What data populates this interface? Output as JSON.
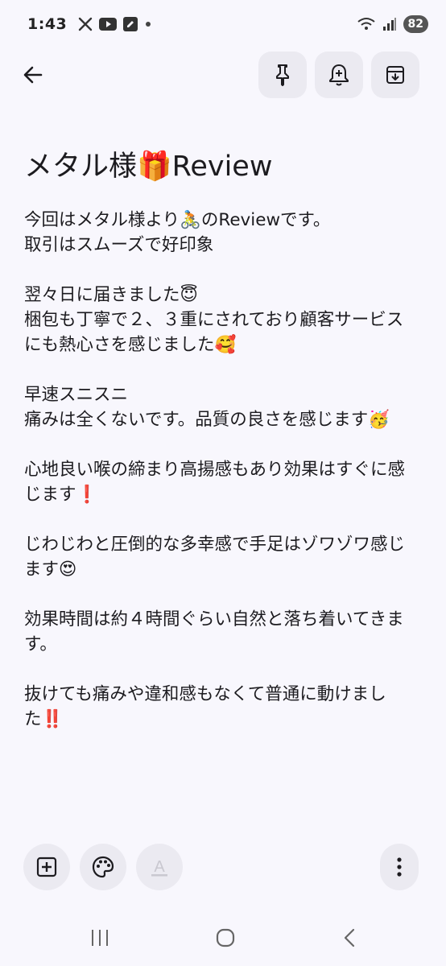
{
  "status_bar": {
    "time": "1:43",
    "battery": "82",
    "icons": [
      "x-icon",
      "youtube-icon",
      "edit-icon",
      "dot-icon",
      "wifi-icon",
      "signal-icon"
    ]
  },
  "toolbar": {
    "icons": [
      "back-arrow-icon",
      "pin-icon",
      "add-alert-icon",
      "archive-icon"
    ]
  },
  "note": {
    "title": "メタル様🎁Review",
    "lines": [
      "今回はメタル様より🚴のReviewです。",
      "取引はスムーズで好印象",
      "",
      "翌々日に届きました😇",
      "梱包も丁寧で２、３重にされており顧客サービス",
      "にも熱心さを感じました🥰",
      "",
      "早速スニスニ",
      "痛みは全くないです。品質の良さを感じます🥳",
      "",
      "心地良い喉の締まり高揚感もあり効果はすぐに感",
      "じます❗",
      "",
      "じわじわと圧倒的な多幸感で手足はゾワゾワ感じ",
      "ます😍",
      "",
      "効果時間は約４時間ぐらい自然と落ち着いてきま",
      "す。",
      "",
      "抜けても痛みや違和感もなくて普通に動けまし",
      "た‼️"
    ]
  },
  "bottom_toolbar": {
    "format_label": "A",
    "icons": [
      "add-box-icon",
      "palette-icon",
      "text-format-icon",
      "more-vert-icon"
    ]
  },
  "nav_bar": {
    "icons": [
      "recents-icon",
      "home-icon",
      "nav-back-icon"
    ]
  },
  "colors": {
    "background": "#f8f7fd",
    "button_bg": "#ebeaf1",
    "text": "#1c1b1f",
    "disabled": "#c9c8d0"
  }
}
